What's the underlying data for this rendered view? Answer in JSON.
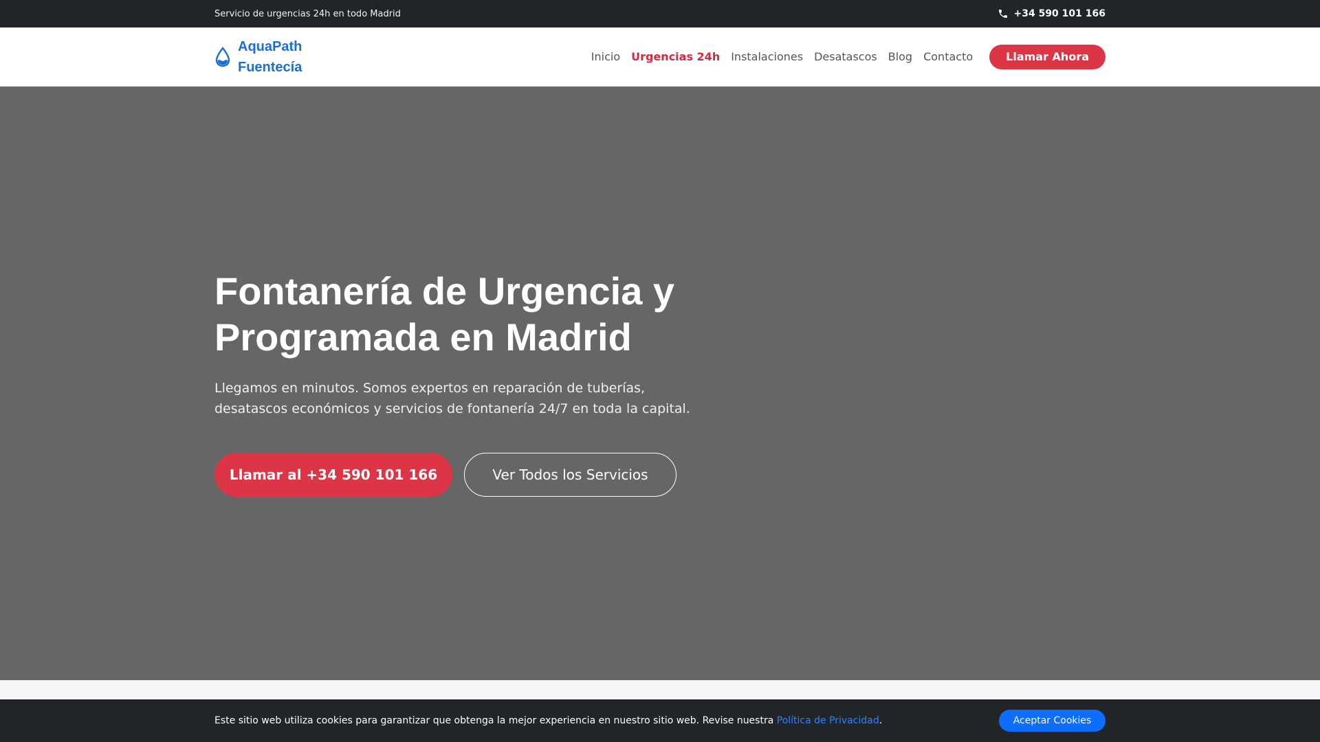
{
  "topbar": {
    "text": "Servicio de urgencias 24h en todo Madrid",
    "phone": "+34 590 101 166",
    "phone_icon": "phone-icon"
  },
  "navbar": {
    "brand_icon": "water-drop-icon",
    "brand_line1": "AquaPath",
    "brand_line2": "Fuentecía",
    "links": [
      {
        "label": "Inicio",
        "active": false
      },
      {
        "label": "Urgencias 24h",
        "active": true
      },
      {
        "label": "Instalaciones",
        "active": false
      },
      {
        "label": "Desatascos",
        "active": false
      },
      {
        "label": "Blog",
        "active": false
      },
      {
        "label": "Contacto",
        "active": false
      }
    ],
    "cta_label": "Llamar Ahora"
  },
  "hero": {
    "title_line1": "Fontanería de Urgencia y",
    "title_line2": "Programada en Madrid",
    "text": "Llegamos en minutos. Somos expertos en reparación de tuberías, desatascos económicos y servicios de fontanería 24/7 en toda la capital.",
    "primary_button": "Llamar al +34 590 101 166",
    "secondary_button": "Ver Todos los Servicios"
  },
  "cookie": {
    "text_before": "Este sitio web utiliza cookies para garantizar que obtenga la mejor experiencia en nuestro sitio web. Revise nuestra ",
    "link_label": "Política de Privacidad",
    "text_after": ".",
    "accept_label": "Aceptar Cookies"
  },
  "colors": {
    "accent_red": "#dc3545",
    "brand_blue": "#1a6ed8",
    "dark": "#212529",
    "hero_bg": "#666666",
    "cookie_button": "#0d6efd"
  }
}
